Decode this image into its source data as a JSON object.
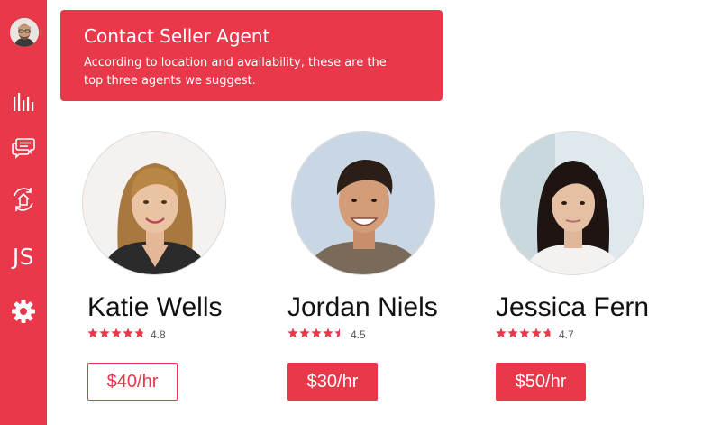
{
  "banner": {
    "title": "Contact Seller Agent",
    "text": "According to location and availability, these are the top three agents we suggest."
  },
  "sidebar": {
    "items": [
      {
        "icon": "bar-chart-icon"
      },
      {
        "icon": "chat-bubbles-icon"
      },
      {
        "icon": "home-refresh-icon"
      },
      {
        "label": "JS"
      },
      {
        "icon": "gear-icon"
      }
    ]
  },
  "agents": [
    {
      "name": "Katie Wells",
      "rating": "4.8",
      "stars": 4.8,
      "price": "$40/hr"
    },
    {
      "name": "Jordan Niels",
      "rating": "4.5",
      "stars": 4.5,
      "price": "$30/hr"
    },
    {
      "name": "Jessica Fern",
      "rating": "4.7",
      "stars": 4.7,
      "price": "$50/hr"
    }
  ],
  "colors": {
    "accent": "#e8384a",
    "background": "#ffffff",
    "text": "#111111"
  }
}
